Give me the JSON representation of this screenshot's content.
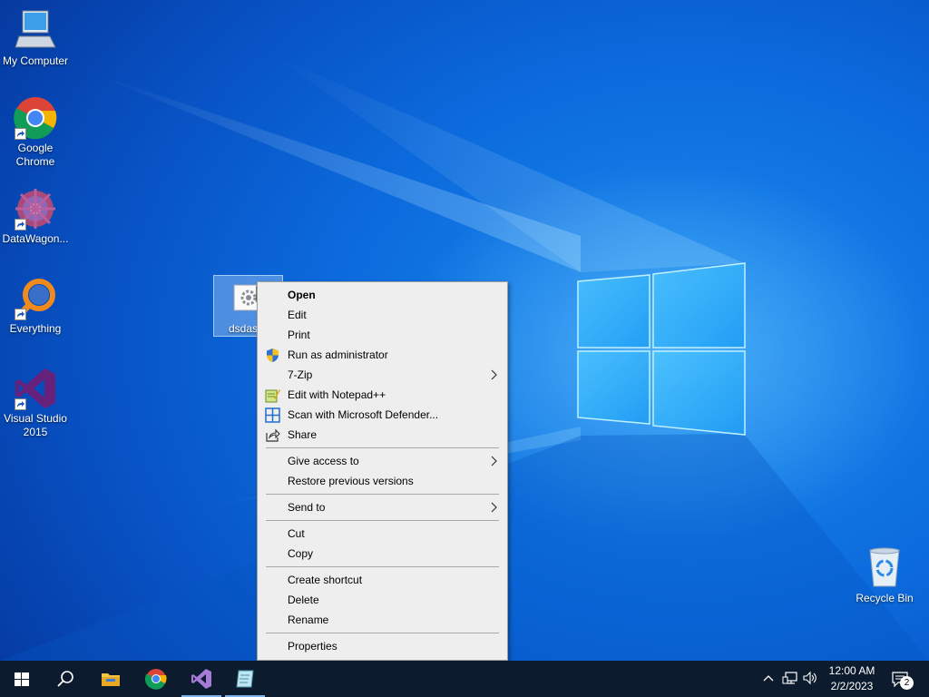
{
  "desktop": {
    "icons": [
      {
        "label": "My Computer",
        "icon": "computer-icon"
      },
      {
        "label": "Google Chrome",
        "icon": "chrome-icon"
      },
      {
        "label": "DataWagon...",
        "icon": "datawagon-icon"
      },
      {
        "label": "Everything",
        "icon": "everything-icon"
      },
      {
        "label": "Visual Studio 2015",
        "icon": "visual-studio-icon"
      },
      {
        "label": "Recycle Bin",
        "icon": "recycle-bin-icon"
      }
    ],
    "selected_file": {
      "label": "dsdas",
      "icon": "settings-file-icon"
    }
  },
  "context_menu": {
    "items": [
      {
        "label": "Open",
        "bold": true
      },
      {
        "label": "Edit"
      },
      {
        "label": "Print"
      },
      {
        "label": "Run as administrator",
        "icon": "uac-shield-icon"
      },
      {
        "label": "7-Zip",
        "submenu": true
      },
      {
        "label": "Edit with Notepad++",
        "icon": "notepadpp-icon"
      },
      {
        "label": "Scan with Microsoft Defender...",
        "icon": "defender-icon"
      },
      {
        "label": "Share",
        "icon": "share-icon"
      },
      {
        "label": "Give access to",
        "submenu": true
      },
      {
        "label": "Restore previous versions"
      },
      {
        "label": "Send to",
        "submenu": true
      },
      {
        "label": "Cut"
      },
      {
        "label": "Copy"
      },
      {
        "label": "Create shortcut"
      },
      {
        "label": "Delete"
      },
      {
        "label": "Rename"
      },
      {
        "label": "Properties"
      }
    ]
  },
  "taskbar": {
    "pinned": [
      "start-icon",
      "search-icon",
      "file-explorer-icon",
      "chrome-icon",
      "visual-studio-icon",
      "notepad-icon"
    ],
    "clock": {
      "time": "12:00 AM",
      "date": "2/2/2023"
    },
    "notification_count": "2"
  },
  "colors": {
    "taskbar": "#0c1c2e",
    "menu_bg": "#eeeeee",
    "desktop_blue": "#0c6adc"
  }
}
